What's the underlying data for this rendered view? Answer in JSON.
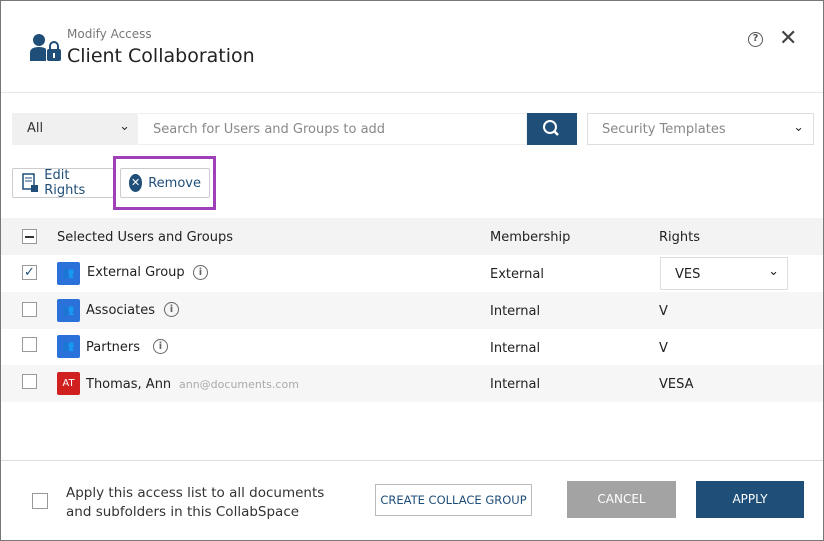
{
  "header": {
    "subtitle": "Modify Access",
    "title": "Client Collaboration",
    "help_icon": "?",
    "close_icon": "✕"
  },
  "toolbar": {
    "filter_value": "All",
    "search_placeholder": "Search for Users and Groups to add",
    "templates_placeholder": "Security Templates",
    "edit_rights": "Edit Rights",
    "remove": "Remove"
  },
  "table": {
    "columns": [
      "Selected Users and Groups",
      "Membership",
      "Rights"
    ],
    "rows": [
      {
        "name": "External Group",
        "type": "group",
        "email": "",
        "membership": "External",
        "rights": "VES",
        "checked": true,
        "editable": true
      },
      {
        "name": "Associates",
        "type": "group",
        "email": "",
        "membership": "Internal",
        "rights": "V",
        "checked": false
      },
      {
        "name": "Partners",
        "type": "group",
        "email": "",
        "membership": "Internal",
        "rights": "V",
        "checked": false
      },
      {
        "name": "Thomas, Ann",
        "type": "user",
        "initials": "AT",
        "email": "ann@documents.com",
        "membership": "Internal",
        "rights": "VESA",
        "checked": false
      }
    ]
  },
  "footer": {
    "apply_all": "Apply this access list to all documents and subfolders in this CollabSpace",
    "create_group": "CREATE COLLACE GROUP",
    "cancel": "CANCEL",
    "apply": "APPLY"
  },
  "colors": {
    "primary": "#1f4e79",
    "group": "#2a72d9",
    "user": "#d0201f",
    "highlight": "#a040b8"
  }
}
